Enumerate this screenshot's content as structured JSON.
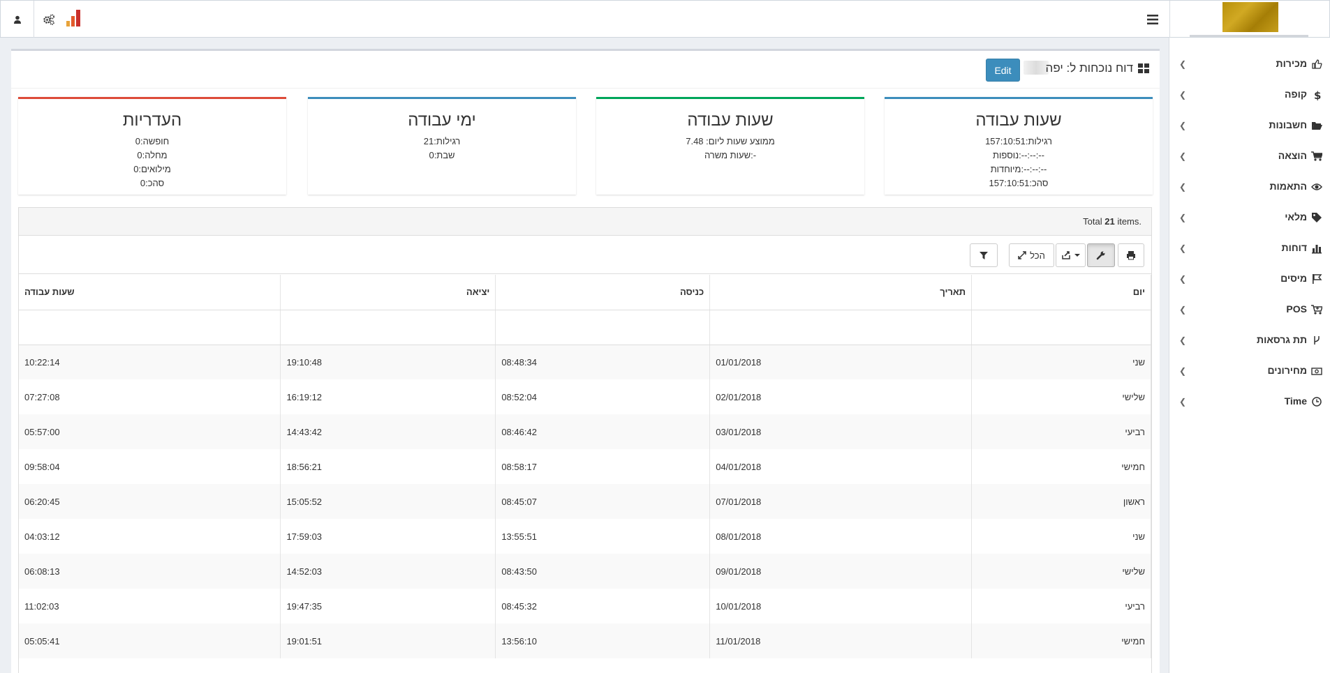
{
  "sidebar": {
    "items": [
      {
        "label": "מכירות",
        "icon": "thumbs-up-icon"
      },
      {
        "label": "קופה",
        "icon": "dollar-icon"
      },
      {
        "label": "חשבונות",
        "icon": "folder-open-icon"
      },
      {
        "label": "הוצאה",
        "icon": "cart-icon"
      },
      {
        "label": "התאמות",
        "icon": "eye-icon"
      },
      {
        "label": "מלאי",
        "icon": "tag-icon"
      },
      {
        "label": "דוחות",
        "icon": "bar-chart-icon"
      },
      {
        "label": "מיסים",
        "icon": "flag-icon"
      },
      {
        "label": "POS",
        "icon": "cart-plus-icon"
      },
      {
        "label": "תת גרסאות",
        "icon": "branch-icon"
      },
      {
        "label": "מחירונים",
        "icon": "money-icon"
      },
      {
        "label": "Time",
        "icon": "clock-icon"
      }
    ]
  },
  "header": {
    "title": "דוח נוכחות ל: יפה",
    "edit_label": "Edit"
  },
  "stats": {
    "hours": {
      "title": "שעות עבודה",
      "regular": "רגילות:157:10:51",
      "extra": "נוספות:--:--:--",
      "special": "מיוחדות:--:--:--",
      "total": "סהכ:157:10:51"
    },
    "avg": {
      "title": "שעות עבודה",
      "daily_avg": "ממוצע שעות ליום: 7.48",
      "position": "שעות משרה:-"
    },
    "days": {
      "title": "ימי עבודה",
      "regular": "רגילות:21",
      "sabbath": "שבת:0"
    },
    "absence": {
      "title": "העדריות",
      "vacation": "חופשה:0",
      "sick": "מחלה:0",
      "reserve": "מילואים:0",
      "total": "סהכ:0"
    }
  },
  "grid": {
    "summary_prefix": "Total ",
    "summary_count": "21",
    "summary_suffix": " items.",
    "toolbar": {
      "all_label": "הכל"
    },
    "columns": [
      "יום",
      "תאריך",
      "כניסה",
      "יציאה",
      "שעות עבודה"
    ],
    "rows": [
      [
        "שני",
        "01/01/2018",
        "08:48:34",
        "19:10:48",
        "10:22:14"
      ],
      [
        "שלישי",
        "02/01/2018",
        "08:52:04",
        "16:19:12",
        "07:27:08"
      ],
      [
        "רביעי",
        "03/01/2018",
        "08:46:42",
        "14:43:42",
        "05:57:00"
      ],
      [
        "חמישי",
        "04/01/2018",
        "08:58:17",
        "18:56:21",
        "09:58:04"
      ],
      [
        "ראשון",
        "07/01/2018",
        "08:45:07",
        "15:05:52",
        "06:20:45"
      ],
      [
        "שני",
        "08/01/2018",
        "13:55:51",
        "17:59:03",
        "04:03:12"
      ],
      [
        "שלישי",
        "09/01/2018",
        "08:43:50",
        "14:52:03",
        "06:08:13"
      ],
      [
        "רביעי",
        "10/01/2018",
        "08:45:32",
        "19:47:35",
        "11:02:03"
      ],
      [
        "חמישי",
        "11/01/2018",
        "13:56:10",
        "19:01:51",
        "05:05:41"
      ]
    ]
  }
}
